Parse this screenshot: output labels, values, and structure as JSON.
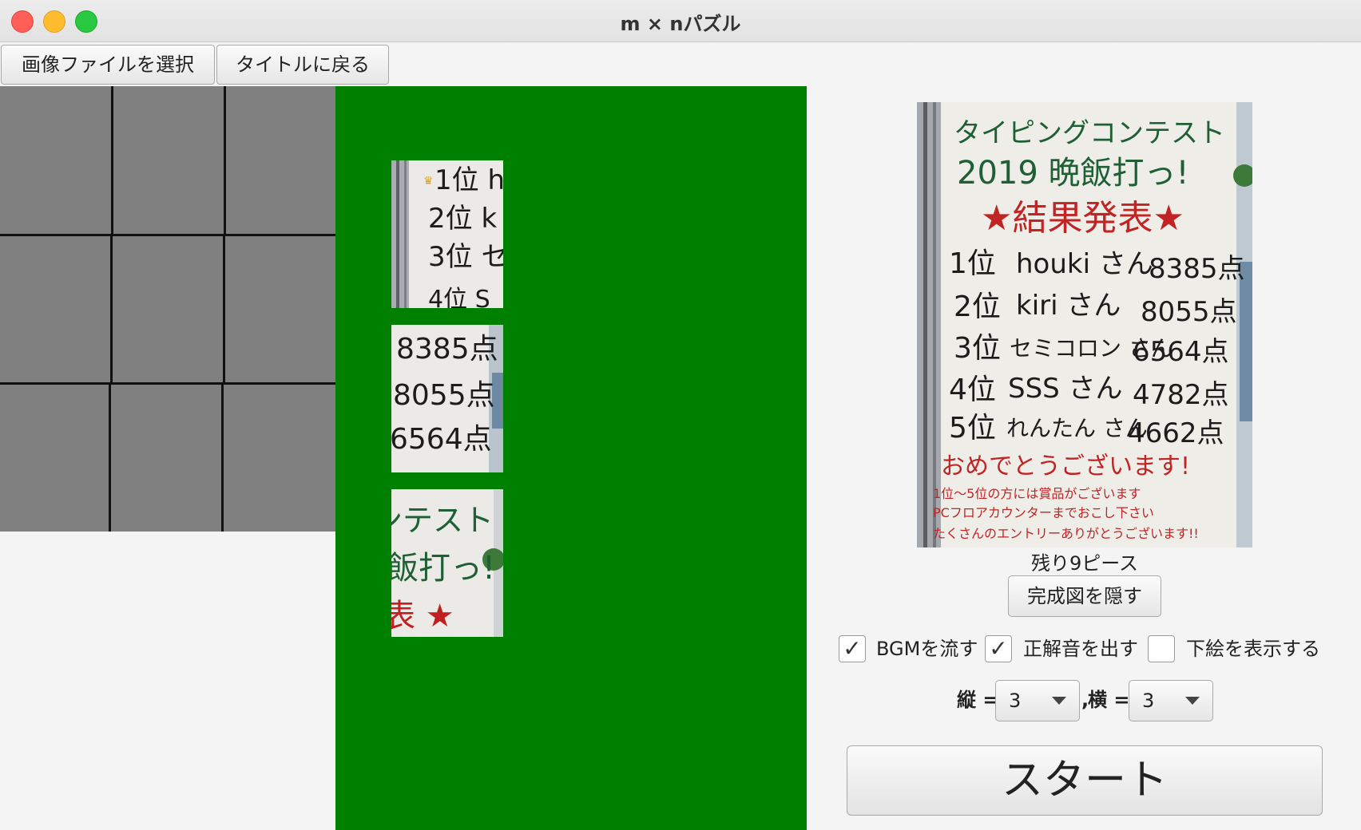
{
  "window": {
    "title": "m × nパズル"
  },
  "toolbar": {
    "select_image": "画像ファイルを選択",
    "back_to_title": "タイトルに戻る"
  },
  "board": {
    "rows": 3,
    "cols": 3,
    "color": "#808080"
  },
  "tray": {
    "color": "#008000",
    "pieces": [
      {
        "lines": [
          "1位 h",
          "2位 k",
          "3位 セ",
          "4位 S"
        ]
      },
      {
        "lines": [
          "8385点",
          "8055点",
          "6564点"
        ]
      },
      {
        "lines": [
          "ンテスト",
          "飯打っ!",
          "表 ★"
        ]
      }
    ]
  },
  "preview": {
    "heading1": "タイピングコンテスト",
    "heading2": "2019 晩飯打っ!",
    "heading3": "★結果発表★",
    "ranks": [
      {
        "rank": "1位",
        "name": "houki さん",
        "score": "8385点"
      },
      {
        "rank": "2位",
        "name": "kiri さん",
        "score": "8055点"
      },
      {
        "rank": "3位",
        "name": "セミコロン さん",
        "score": "6564点"
      },
      {
        "rank": "4位",
        "name": "SSS さん",
        "score": "4782点"
      },
      {
        "rank": "5位",
        "name": "れんたん さん",
        "score": "4662点"
      }
    ],
    "congrats": "おめでとうございます!",
    "note1": "1位〜5位の方には賞品がございます",
    "note2": "PCフロアカウンターまでおこし下さい",
    "note3": "たくさんのエントリーありがとうございます!!"
  },
  "status": {
    "remaining": "残り9ピース"
  },
  "hide_preview_label": "完成図を隠す",
  "options": {
    "bgm": {
      "label": "BGMを流す",
      "checked": true,
      "mark": "✓"
    },
    "correct_sound": {
      "label": "正解音を出す",
      "checked": true,
      "mark": "✓"
    },
    "underlay": {
      "label": "下絵を表示する",
      "checked": false,
      "mark": ""
    }
  },
  "dims": {
    "rows_label": "縦 =",
    "rows_value": "3",
    "separator": ",",
    "cols_label": "横 =",
    "cols_value": "3"
  },
  "start_label": "スタート"
}
